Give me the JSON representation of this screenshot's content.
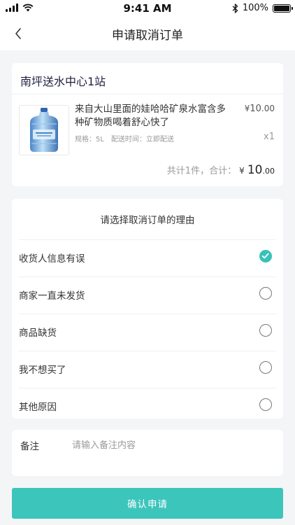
{
  "status_bar": {
    "time": "9:41 AM",
    "battery": "100%",
    "icons": [
      "signal-icon",
      "wifi-icon",
      "bluetooth-icon",
      "battery-icon"
    ]
  },
  "nav": {
    "title": "申请取消订单",
    "back_icon": "chevron-left-icon"
  },
  "order": {
    "shop_name": "南坪送水中心1站",
    "product": {
      "name": "来自大山里面的娃哈哈矿泉水富含多种矿物质喝着舒心快了",
      "spec": "规格：5L",
      "delivery": "配送时间：立即配送",
      "price_symbol": "¥",
      "price_int": "10",
      "price_dec": ".00",
      "qty": "x1"
    },
    "total_label": "共计1件，合计：",
    "total_symbol": "¥",
    "total_int": "10",
    "total_dec": ".00"
  },
  "reasons": {
    "header": "请选择取消订单的理由",
    "items": [
      {
        "label": "收货人信息有误",
        "checked": true
      },
      {
        "label": "商家一直未发货",
        "checked": false
      },
      {
        "label": "商品缺货",
        "checked": false
      },
      {
        "label": "我不想买了",
        "checked": false
      },
      {
        "label": "其他原因",
        "checked": false
      }
    ]
  },
  "remark": {
    "label": "备注",
    "placeholder": "请输入备注内容",
    "value": ""
  },
  "confirm_label": "确认申请",
  "colors": {
    "accent": "#3cc5bb",
    "background": "#f4f5f7"
  }
}
